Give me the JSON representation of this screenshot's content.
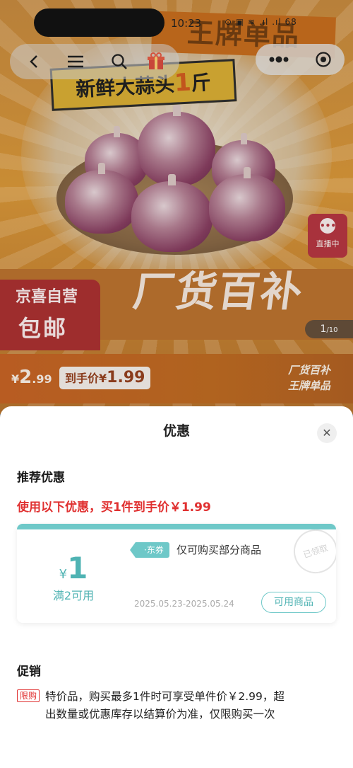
{
  "status_bar": {
    "time": "10:23",
    "right_icons": "⊙ ▣ ≋ .ıl .ıl 68"
  },
  "nav": {
    "back_icon": "back-icon",
    "menu_icon": "menu-icon",
    "search_icon": "search-icon",
    "gift_icon": "gift-icon"
  },
  "hero": {
    "banner_top": "王牌单品",
    "banner_title_pre": "新鲜大蒜头",
    "banner_title_num": "1",
    "banner_title_unit": "斤",
    "factory_text": "厂货百补",
    "jd_tag_line1": "京喜自营",
    "jd_tag_line2": "包邮",
    "live_label": "直播中",
    "page_current": "1",
    "page_total": "/10"
  },
  "price": {
    "symbol": "¥",
    "int": "2",
    "dec": ".99",
    "final_label": "到手价",
    "final_symbol": "¥",
    "final_value": "1.99",
    "brand_line1": "厂货百补",
    "brand_line2": "王牌单品"
  },
  "sheet": {
    "title": "优惠",
    "close_label": "✕",
    "recommend_title": "推荐优惠",
    "recommend_line": "使用以下优惠，买1件到手价￥1.99",
    "coupon": {
      "symbol": "¥",
      "amount": "1",
      "condition": "满2可用",
      "tag": "·东券",
      "description": "仅可购买部分商品",
      "date_range": "2025.05.23-2025.05.24",
      "button_label": "可用商品",
      "stamp_text": "已领取"
    },
    "promo_title": "促销",
    "promo_tag": "限购",
    "promo_text_line1": "特价品，购买最多1件时可享受单件价￥2.99，超",
    "promo_text_line2": "出数量或优惠库存以结算价为准，仅限购买一次"
  },
  "colors": {
    "accent_red": "#e03030",
    "coupon_teal": "#6ec8c8"
  }
}
